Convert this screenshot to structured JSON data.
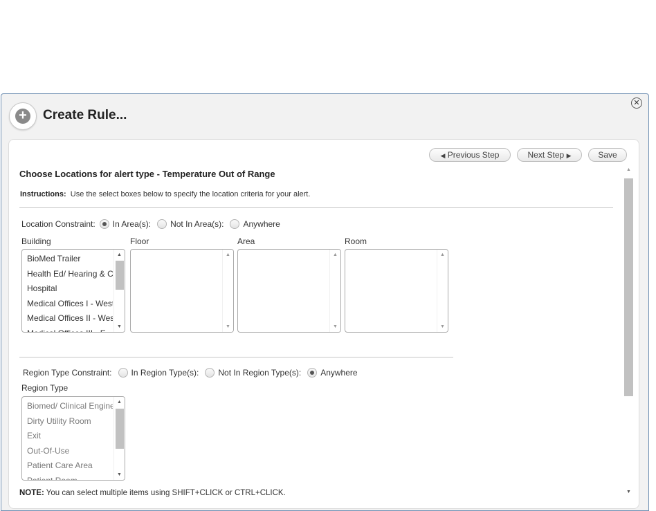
{
  "dialog": {
    "title": "Create Rule...",
    "plus_glyph": "+",
    "close_glyph": "✕"
  },
  "toolbar": {
    "previous_label": "Previous Step",
    "next_label": "Next Step",
    "save_label": "Save"
  },
  "heading": "Choose Locations for alert type - Temperature Out of Range",
  "instructions": {
    "label": "Instructions:",
    "text": "Use the select boxes below to specify the location criteria for your alert."
  },
  "location_constraint": {
    "label": "Location Constraint:",
    "options": [
      {
        "label": "In Area(s):",
        "checked": true
      },
      {
        "label": "Not In Area(s):",
        "checked": false
      },
      {
        "label": "Anywhere",
        "checked": false
      }
    ]
  },
  "columns": {
    "building": "Building",
    "floor": "Floor",
    "area": "Area",
    "room": "Room"
  },
  "building_items": [
    "BioMed Trailer",
    "Health Ed/ Hearing & C",
    "Hospital",
    "Medical Offices I - West",
    "Medical Offices II - West",
    "Medical Offices III - E"
  ],
  "region_constraint": {
    "label": "Region Type Constraint:",
    "options": [
      {
        "label": "In Region Type(s):",
        "checked": false
      },
      {
        "label": "Not In Region Type(s):",
        "checked": false
      },
      {
        "label": "Anywhere",
        "checked": true
      }
    ]
  },
  "region_type_label": "Region Type",
  "region_items": [
    "Biomed/ Clinical Engineering",
    "Dirty Utility Room",
    "Exit",
    "Out-Of-Use",
    "Patient Care Area",
    "Patient Room"
  ],
  "note": {
    "label": "NOTE:",
    "text": "You can select multiple items using SHIFT+CLICK or CTRL+CLICK."
  }
}
